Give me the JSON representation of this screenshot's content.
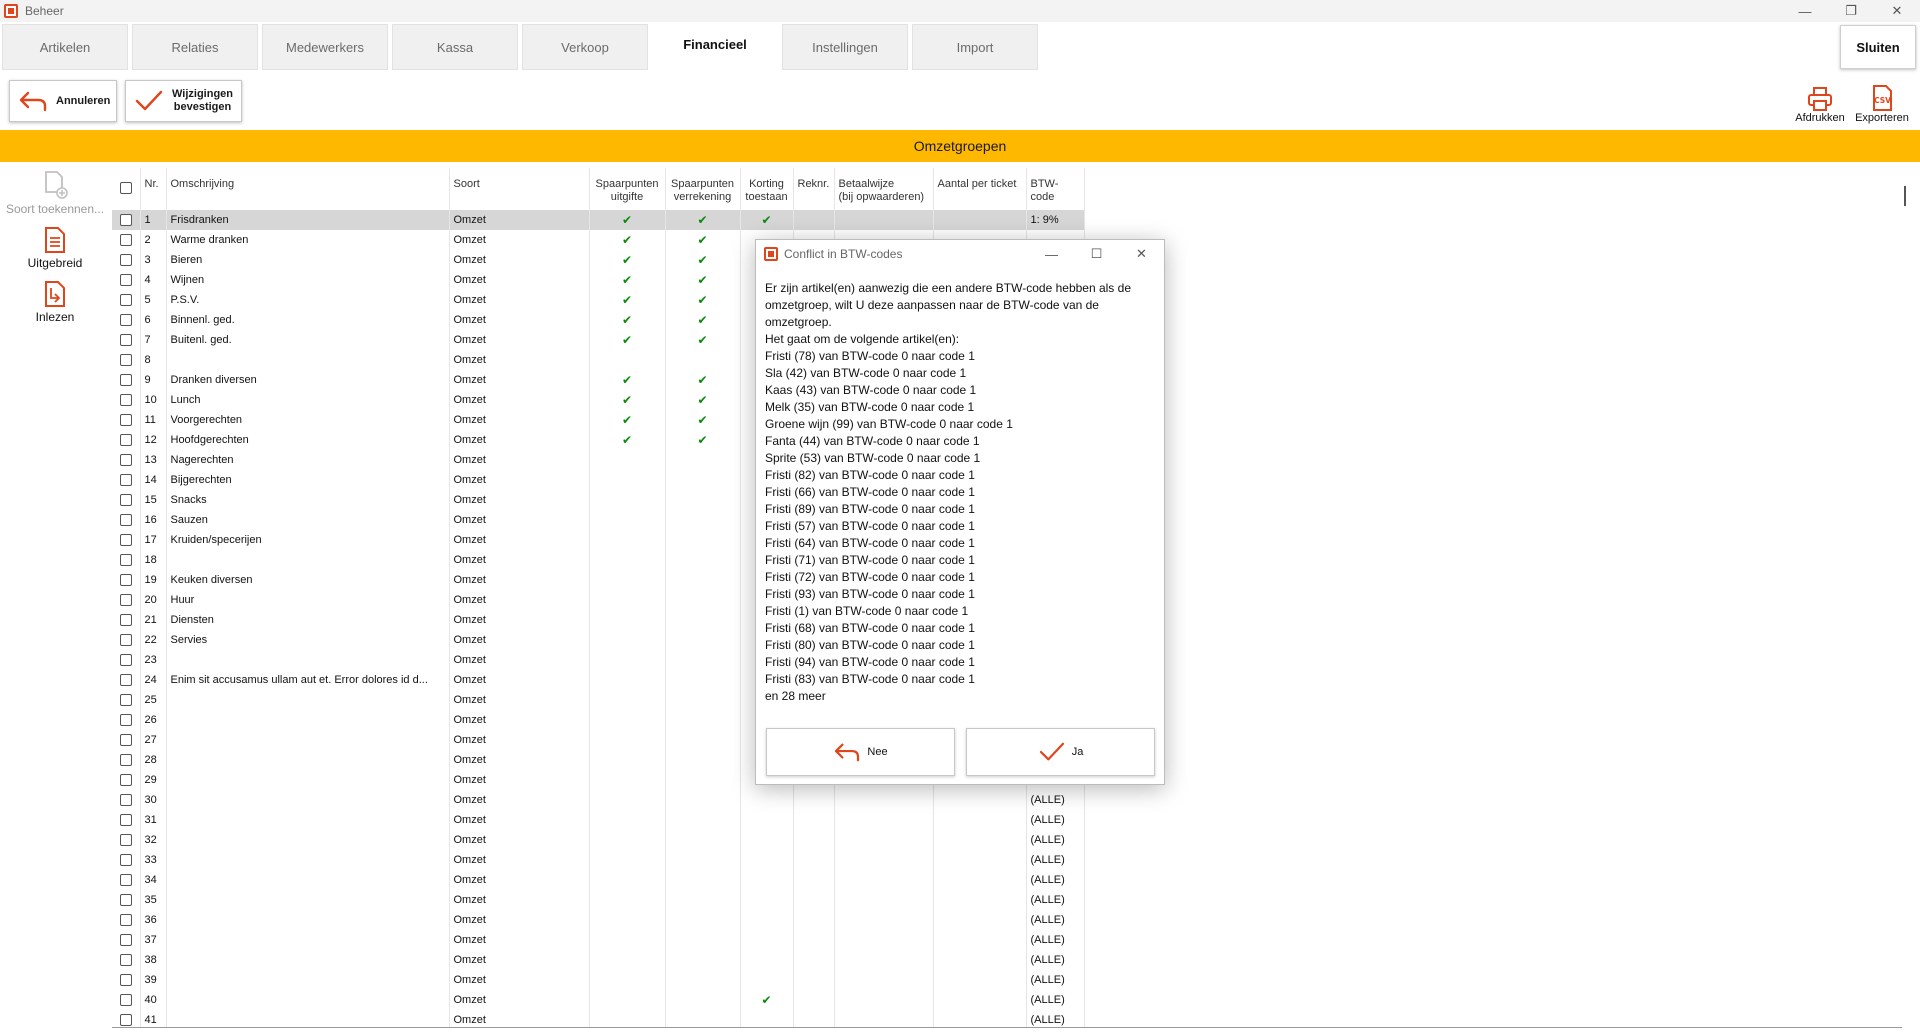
{
  "window": {
    "title": "Beheer"
  },
  "tabs": [
    {
      "label": "Artikelen"
    },
    {
      "label": "Relaties"
    },
    {
      "label": "Medewerkers"
    },
    {
      "label": "Kassa"
    },
    {
      "label": "Verkoop"
    },
    {
      "label": "Financieel"
    },
    {
      "label": "Instellingen"
    },
    {
      "label": "Import"
    }
  ],
  "close_button": "Sluiten",
  "toolbar": {
    "cancel_label": "Annuleren",
    "confirm_line1": "Wijzigingen",
    "confirm_line2": "bevestigen",
    "print_label": "Afdrukken",
    "export_label": "Exporteren",
    "export_icon_text": "CSV"
  },
  "section_title": "Omzetgroepen",
  "side_panel": {
    "assign_label": "Soort toekennen...",
    "extended_label": "Uitgebreid",
    "import_label": "Inlezen"
  },
  "table": {
    "headers": {
      "nr": "Nr.",
      "omschrijving": "Omschrijving",
      "soort": "Soort",
      "sp_uitgifte_1": "Spaarpunten",
      "sp_uitgifte_2": "uitgifte",
      "sp_verrekening_1": "Spaarpunten",
      "sp_verrekening_2": "verrekening",
      "korting_1": "Korting",
      "korting_2": "toestaan",
      "reknr": "Reknr.",
      "betaalwijze_1": "Betaalwijze",
      "betaalwijze_2": "(bij opwaarderen)",
      "aantal": "Aantal per ticket",
      "btw": "BTW-code"
    },
    "rows": [
      {
        "nr": "1",
        "desc": "Frisdranken",
        "soort": "Omzet",
        "sp_u": true,
        "sp_v": true,
        "korting": true,
        "btw": "1: 9%",
        "selected": true
      },
      {
        "nr": "2",
        "desc": "Warme dranken",
        "soort": "Omzet",
        "sp_u": true,
        "sp_v": true,
        "korting": false,
        "btw": ""
      },
      {
        "nr": "3",
        "desc": "Bieren",
        "soort": "Omzet",
        "sp_u": true,
        "sp_v": true,
        "korting": false,
        "btw": ""
      },
      {
        "nr": "4",
        "desc": "Wijnen",
        "soort": "Omzet",
        "sp_u": true,
        "sp_v": true,
        "korting": false,
        "btw": ""
      },
      {
        "nr": "5",
        "desc": "P.S.V.",
        "soort": "Omzet",
        "sp_u": true,
        "sp_v": true,
        "korting": false,
        "btw": ""
      },
      {
        "nr": "6",
        "desc": "Binnenl. ged.",
        "soort": "Omzet",
        "sp_u": true,
        "sp_v": true,
        "korting": false,
        "btw": ""
      },
      {
        "nr": "7",
        "desc": "Buitenl. ged.",
        "soort": "Omzet",
        "sp_u": true,
        "sp_v": true,
        "korting": false,
        "btw": ""
      },
      {
        "nr": "8",
        "desc": "",
        "soort": "Omzet",
        "sp_u": false,
        "sp_v": false,
        "korting": false,
        "btw": ""
      },
      {
        "nr": "9",
        "desc": "Dranken diversen",
        "soort": "Omzet",
        "sp_u": true,
        "sp_v": true,
        "korting": false,
        "btw": ""
      },
      {
        "nr": "10",
        "desc": "Lunch",
        "soort": "Omzet",
        "sp_u": true,
        "sp_v": true,
        "korting": false,
        "btw": ""
      },
      {
        "nr": "11",
        "desc": "Voorgerechten",
        "soort": "Omzet",
        "sp_u": true,
        "sp_v": true,
        "korting": false,
        "btw": ""
      },
      {
        "nr": "12",
        "desc": "Hoofdgerechten",
        "soort": "Omzet",
        "sp_u": true,
        "sp_v": true,
        "korting": false,
        "btw": ""
      },
      {
        "nr": "13",
        "desc": "Nagerechten",
        "soort": "Omzet",
        "sp_u": false,
        "sp_v": false,
        "korting": false,
        "btw": ""
      },
      {
        "nr": "14",
        "desc": "Bijgerechten",
        "soort": "Omzet",
        "sp_u": false,
        "sp_v": false,
        "korting": false,
        "btw": ""
      },
      {
        "nr": "15",
        "desc": "Snacks",
        "soort": "Omzet",
        "sp_u": false,
        "sp_v": false,
        "korting": false,
        "btw": ""
      },
      {
        "nr": "16",
        "desc": "Sauzen",
        "soort": "Omzet",
        "sp_u": false,
        "sp_v": false,
        "korting": false,
        "btw": ""
      },
      {
        "nr": "17",
        "desc": "Kruiden/specerijen",
        "soort": "Omzet",
        "sp_u": false,
        "sp_v": false,
        "korting": false,
        "btw": ""
      },
      {
        "nr": "18",
        "desc": "",
        "soort": "Omzet",
        "sp_u": false,
        "sp_v": false,
        "korting": false,
        "btw": ""
      },
      {
        "nr": "19",
        "desc": "Keuken diversen",
        "soort": "Omzet",
        "sp_u": false,
        "sp_v": false,
        "korting": false,
        "btw": ""
      },
      {
        "nr": "20",
        "desc": "Huur",
        "soort": "Omzet",
        "sp_u": false,
        "sp_v": false,
        "korting": false,
        "btw": ""
      },
      {
        "nr": "21",
        "desc": "Diensten",
        "soort": "Omzet",
        "sp_u": false,
        "sp_v": false,
        "korting": false,
        "btw": ""
      },
      {
        "nr": "22",
        "desc": "Servies",
        "soort": "Omzet",
        "sp_u": false,
        "sp_v": false,
        "korting": false,
        "btw": ""
      },
      {
        "nr": "23",
        "desc": "",
        "soort": "Omzet",
        "sp_u": false,
        "sp_v": false,
        "korting": false,
        "btw": ""
      },
      {
        "nr": "24",
        "desc": "Enim sit accusamus ullam aut et. Error dolores id d...",
        "soort": "Omzet",
        "sp_u": false,
        "sp_v": false,
        "korting": false,
        "btw": ""
      },
      {
        "nr": "25",
        "desc": "",
        "soort": "Omzet",
        "sp_u": false,
        "sp_v": false,
        "korting": false,
        "btw": ""
      },
      {
        "nr": "26",
        "desc": "",
        "soort": "Omzet",
        "sp_u": false,
        "sp_v": false,
        "korting": false,
        "btw": ""
      },
      {
        "nr": "27",
        "desc": "",
        "soort": "Omzet",
        "sp_u": false,
        "sp_v": false,
        "korting": false,
        "btw": ""
      },
      {
        "nr": "28",
        "desc": "",
        "soort": "Omzet",
        "sp_u": false,
        "sp_v": false,
        "korting": false,
        "btw": ""
      },
      {
        "nr": "29",
        "desc": "",
        "soort": "Omzet",
        "sp_u": false,
        "sp_v": false,
        "korting": false,
        "btw": ""
      },
      {
        "nr": "30",
        "desc": "",
        "soort": "Omzet",
        "sp_u": false,
        "sp_v": false,
        "korting": false,
        "btw": "(ALLE)"
      },
      {
        "nr": "31",
        "desc": "",
        "soort": "Omzet",
        "sp_u": false,
        "sp_v": false,
        "korting": false,
        "btw": "(ALLE)"
      },
      {
        "nr": "32",
        "desc": "",
        "soort": "Omzet",
        "sp_u": false,
        "sp_v": false,
        "korting": false,
        "btw": "(ALLE)"
      },
      {
        "nr": "33",
        "desc": "",
        "soort": "Omzet",
        "sp_u": false,
        "sp_v": false,
        "korting": false,
        "btw": "(ALLE)"
      },
      {
        "nr": "34",
        "desc": "",
        "soort": "Omzet",
        "sp_u": false,
        "sp_v": false,
        "korting": false,
        "btw": "(ALLE)"
      },
      {
        "nr": "35",
        "desc": "",
        "soort": "Omzet",
        "sp_u": false,
        "sp_v": false,
        "korting": false,
        "btw": "(ALLE)"
      },
      {
        "nr": "36",
        "desc": "",
        "soort": "Omzet",
        "sp_u": false,
        "sp_v": false,
        "korting": false,
        "btw": "(ALLE)"
      },
      {
        "nr": "37",
        "desc": "",
        "soort": "Omzet",
        "sp_u": false,
        "sp_v": false,
        "korting": false,
        "btw": "(ALLE)"
      },
      {
        "nr": "38",
        "desc": "",
        "soort": "Omzet",
        "sp_u": false,
        "sp_v": false,
        "korting": false,
        "btw": "(ALLE)"
      },
      {
        "nr": "39",
        "desc": "",
        "soort": "Omzet",
        "sp_u": false,
        "sp_v": false,
        "korting": false,
        "btw": "(ALLE)"
      },
      {
        "nr": "40",
        "desc": "",
        "soort": "Omzet",
        "sp_u": false,
        "sp_v": false,
        "korting": true,
        "btw": "(ALLE)"
      },
      {
        "nr": "41",
        "desc": "",
        "soort": "Omzet",
        "sp_u": false,
        "sp_v": false,
        "korting": false,
        "btw": "(ALLE)"
      }
    ]
  },
  "dialog": {
    "title": "Conflict in BTW-codes",
    "message": "Er zijn artikel(en) aanwezig die een andere BTW-code hebben als de omzetgroep, wilt U deze aanpassen naar de BTW-code van de omzetgroep.",
    "list_intro": "Het gaat om de volgende artikel(en):",
    "items": [
      "Fristi (78) van BTW-code 0 naar code 1",
      "Sla (42) van BTW-code 0 naar code 1",
      "Kaas (43) van BTW-code 0 naar code 1",
      "Melk (35) van BTW-code 0 naar code 1",
      "Groene wijn (99) van BTW-code 0 naar code 1",
      "Fanta (44) van BTW-code 0 naar code 1",
      "Sprite (53) van BTW-code 0 naar code 1",
      "Fristi (82) van BTW-code 0 naar code 1",
      "Fristi (66) van BTW-code 0 naar code 1",
      "Fristi (89) van BTW-code 0 naar code 1",
      "Fristi (57) van BTW-code 0 naar code 1",
      "Fristi (64) van BTW-code 0 naar code 1",
      "Fristi (71) van BTW-code 0 naar code 1",
      "Fristi (72) van BTW-code 0 naar code 1",
      "Fristi (93) van BTW-code 0 naar code 1",
      "Fristi (1) van BTW-code 0 naar code 1",
      "Fristi (68) van BTW-code 0 naar code 1",
      "Fristi (80) van BTW-code 0 naar code 1",
      "Fristi (94) van BTW-code 0 naar code 1",
      "Fristi (83) van BTW-code 0 naar code 1"
    ],
    "more": "en 28 meer",
    "no_label": "Nee",
    "yes_label": "Ja"
  },
  "colors": {
    "accent": "#ffb800",
    "brand": "#e0461b",
    "check": "#0a8a0a"
  }
}
